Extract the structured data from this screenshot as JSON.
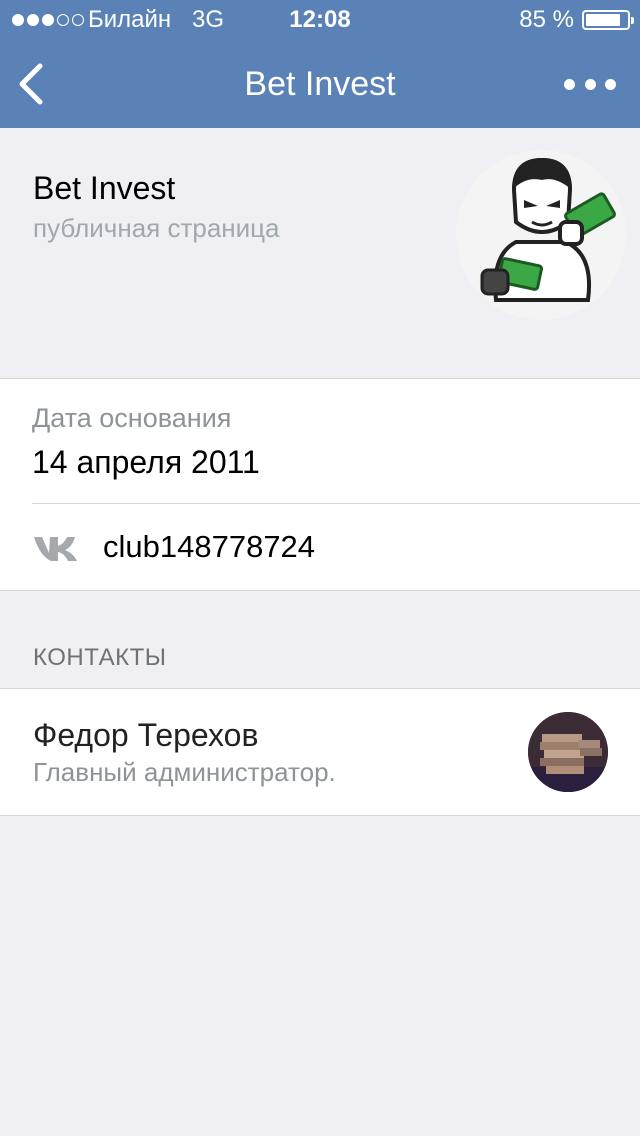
{
  "status_bar": {
    "carrier": "Билайн",
    "network": "3G",
    "time": "12:08",
    "battery_percent": "85 %",
    "battery_level": 0.85,
    "signal_bars_filled": 3,
    "signal_bars_total": 5
  },
  "nav": {
    "back_icon": "chevron-left-icon",
    "title": "Bet Invest",
    "more_icon": "more-dots-icon"
  },
  "profile": {
    "name": "Bet Invest",
    "type": "публичная страница",
    "avatar_icon": "community-avatar"
  },
  "info": {
    "founded_label": "Дата основания",
    "founded_value": "14 апреля 2011",
    "link_icon": "vk-icon",
    "link_text": "club148778724"
  },
  "contacts": {
    "header": "КОНТАКТЫ",
    "items": [
      {
        "name": "Федор Терехов",
        "role": "Главный администратор."
      }
    ]
  },
  "colors": {
    "header_bg": "#5b82b6",
    "page_bg": "#efeff4",
    "secondary_text": "#8e939a"
  }
}
